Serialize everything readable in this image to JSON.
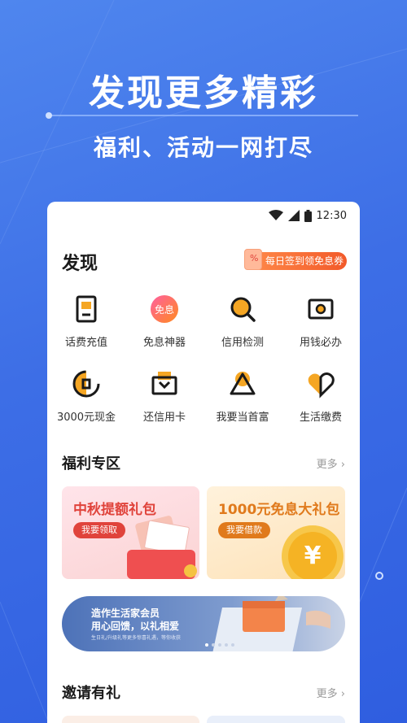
{
  "hero": {
    "title": "发现更多精彩",
    "subtitle": "福利、活动一网打尽"
  },
  "status_bar": {
    "time": "12:30",
    "icons": [
      "wifi-icon",
      "signal-icon",
      "battery-icon"
    ]
  },
  "discover": {
    "title": "发现",
    "promo_label": "每日签到领免息券",
    "promo_ticket_glyph": "%",
    "items": [
      {
        "label": "话费充值",
        "icon": "phone-recharge-icon"
      },
      {
        "label": "免息神器",
        "icon": "interest-free-icon",
        "icon_text": "免息"
      },
      {
        "label": "信用检测",
        "icon": "credit-check-icon"
      },
      {
        "label": "用钱必办",
        "icon": "wallet-card-icon"
      },
      {
        "label": "3000元现金",
        "icon": "cash-coin-icon"
      },
      {
        "label": "还信用卡",
        "icon": "credit-card-repay-icon"
      },
      {
        "label": "我要当首富",
        "icon": "triangle-rich-icon"
      },
      {
        "label": "生活缴费",
        "icon": "life-payment-icon"
      }
    ]
  },
  "benefits": {
    "title": "福利专区",
    "more": "更多",
    "cards": [
      {
        "title": "中秋提额礼包",
        "button": "我要领取",
        "color": "#e0433b"
      },
      {
        "title": "1000元免息大礼包",
        "button": "我要借款",
        "color": "#e07a1c",
        "coin_glyph": "¥"
      }
    ]
  },
  "banner": {
    "line1": "造作生活家会员",
    "line2": "用心回馈，以礼相爱",
    "line3": "生日礼/升级礼等更多惊喜礼遇，等你收获",
    "active_dot": 0,
    "dot_count": 5
  },
  "invite": {
    "title": "邀请有礼",
    "more": "更多"
  },
  "colors": {
    "accent_orange": "#f25a2a",
    "background_blue": "#3d6ee6"
  }
}
